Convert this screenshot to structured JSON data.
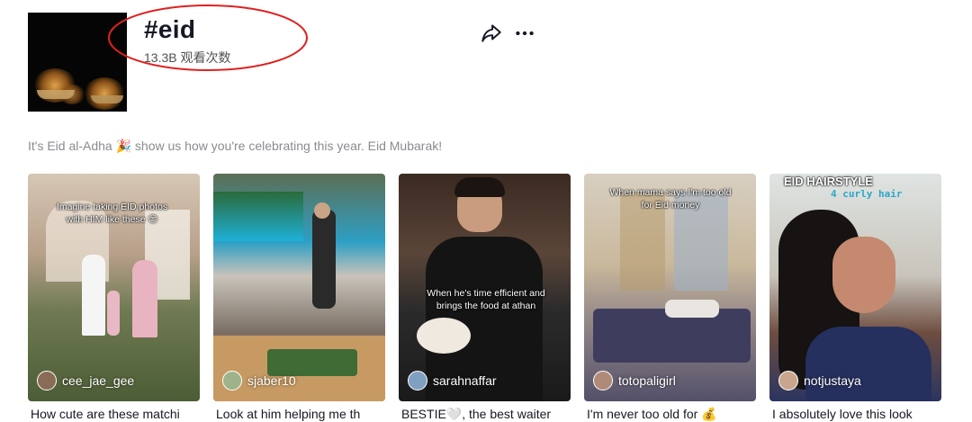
{
  "hashtag": {
    "title": "#eid",
    "views": "13.3B 观看次数"
  },
  "icons": {
    "share": "share-arrow-icon",
    "more": "more-dots-icon"
  },
  "description": "It's Eid al-Adha 🎉 show us how you're celebrating this year. Eid Mubarak!",
  "annotation_color": "#e02020",
  "videos": [
    {
      "overlay": "Imagine taking EID photos with HIM like these 😊",
      "username": "cee_jae_gee",
      "caption": "How cute are these matchi"
    },
    {
      "overlay": "",
      "username": "sjaber10",
      "caption": "Look at him helping me th"
    },
    {
      "overlay": "When he's time efficient and brings the food at athan",
      "username": "sarahnaffar",
      "caption": "BESTIE🤍, the best waiter"
    },
    {
      "overlay": "When mama says I'm too old for Eid money",
      "username": "totopaligirl",
      "caption": "I'm never too old for 💰"
    },
    {
      "overlay": "EID HAIRSTYLE",
      "overlay2": "4 curly hair",
      "username": "notjustaya",
      "caption": "I absolutely love this look"
    }
  ]
}
